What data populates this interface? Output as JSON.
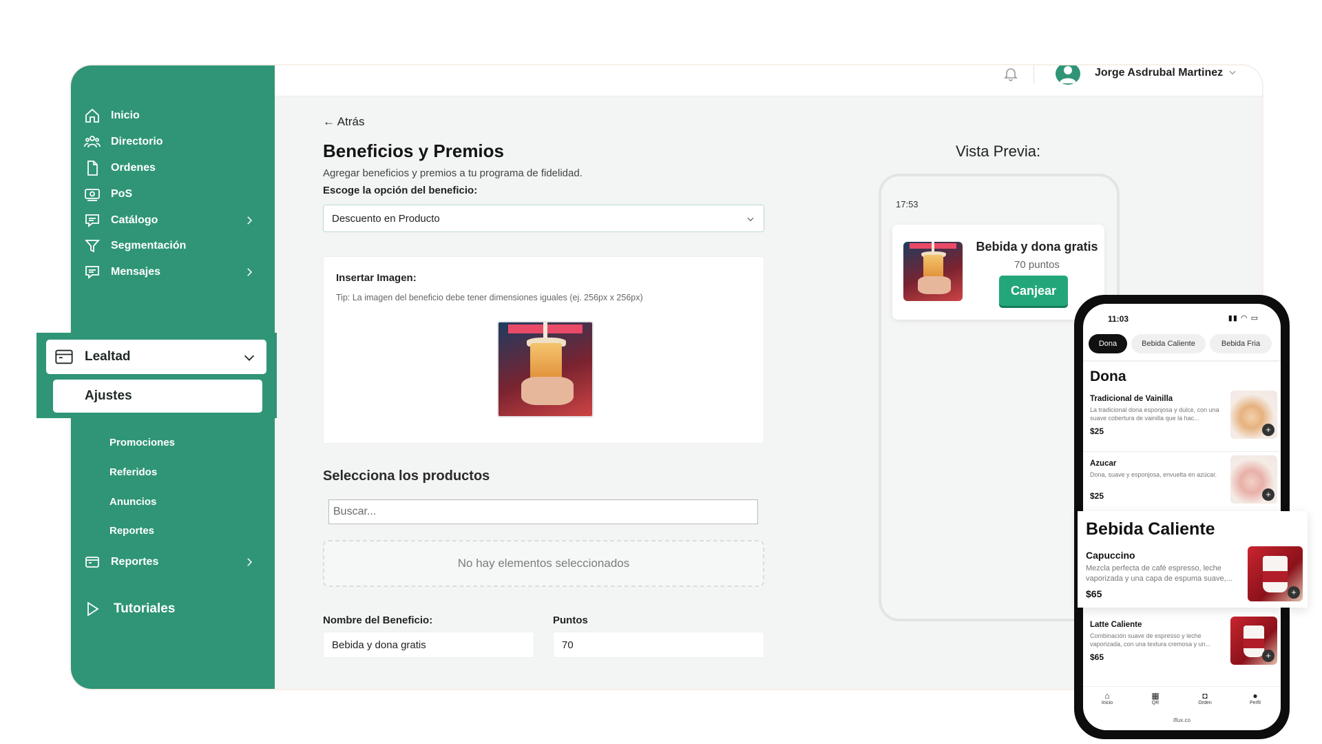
{
  "sidebar": {
    "items": [
      {
        "label": "Inicio",
        "icon": "home-icon"
      },
      {
        "label": "Directorio",
        "icon": "users-icon"
      },
      {
        "label": "Ordenes",
        "icon": "document-icon"
      },
      {
        "label": "PoS",
        "icon": "cash-icon"
      },
      {
        "label": "Catálogo",
        "icon": "catalog-icon"
      },
      {
        "label": "Segmentación",
        "icon": "filter-icon"
      },
      {
        "label": "Mensajes",
        "icon": "message-icon"
      }
    ],
    "active_group": {
      "label": "Lealtad",
      "icon": "wallet-icon"
    },
    "active_sub": "Ajustes",
    "sub_items": [
      "Promociones",
      "Referidos",
      "Anuncios",
      "Reportes"
    ],
    "reportes": {
      "label": "Reportes",
      "icon": "wallet-icon"
    },
    "tutoriales": {
      "label": "Tutoriales",
      "icon": "play-icon"
    }
  },
  "topbar": {
    "user_name": "Jorge Asdrubal Martinez"
  },
  "main": {
    "back": "← Atrás",
    "title": "Beneficios y Premios",
    "subtitle": "Agregar beneficios y premios a tu programa de fidelidad.",
    "option_label": "Escoge la opción del beneficio:",
    "option_value": "Descuento en Producto",
    "image_label": "Insertar Imagen:",
    "image_tip": "Tip: La imagen del beneficio debe tener dimensiones iguales (ej. 256px x 256px)",
    "products_heading": "Selecciona los productos",
    "search_placeholder": "Buscar...",
    "empty_text": "No hay elementos seleccionados",
    "name_label": "Nombre del Beneficio:",
    "name_value": "Bebida y dona gratis",
    "points_label": "Puntos",
    "points_value": "70"
  },
  "preview": {
    "title": "Vista Previa:",
    "time": "17:53",
    "reward_title": "Bebida y dona gratis",
    "reward_points": "70 puntos",
    "redeem": "Canjear"
  },
  "phone": {
    "time": "11:03",
    "chips": [
      "Dona",
      "Bebida Caliente",
      "Bebida Fria"
    ],
    "section_dona": "Dona",
    "items": [
      {
        "name": "Tradicional de Vainilla",
        "desc": "La tradicional dona esponjosa y dulce, con una suave cobertura de vainilla que la hac...",
        "price": "$25"
      },
      {
        "name": "Azucar",
        "desc": "Dona, suave y esponjosa, envuelta en azúcar.",
        "price": "$25"
      },
      {
        "name": "Latte Caliente",
        "desc": "Combinación suave de espresso y leche vaporizada, con una textura cremosa y un...",
        "price": "$65"
      }
    ],
    "popup": {
      "heading": "Bebida Caliente",
      "name": "Capuccino",
      "desc": "Mezcla perfecta de café espresso, leche vaporizada y una capa de espuma suave,...",
      "price": "$65"
    },
    "nav": [
      "Inicio",
      "QR",
      "Orden",
      "Perfil"
    ],
    "url": "iflux.co"
  },
  "colors": {
    "brand": "#2f9576",
    "button": "#22a67a"
  }
}
